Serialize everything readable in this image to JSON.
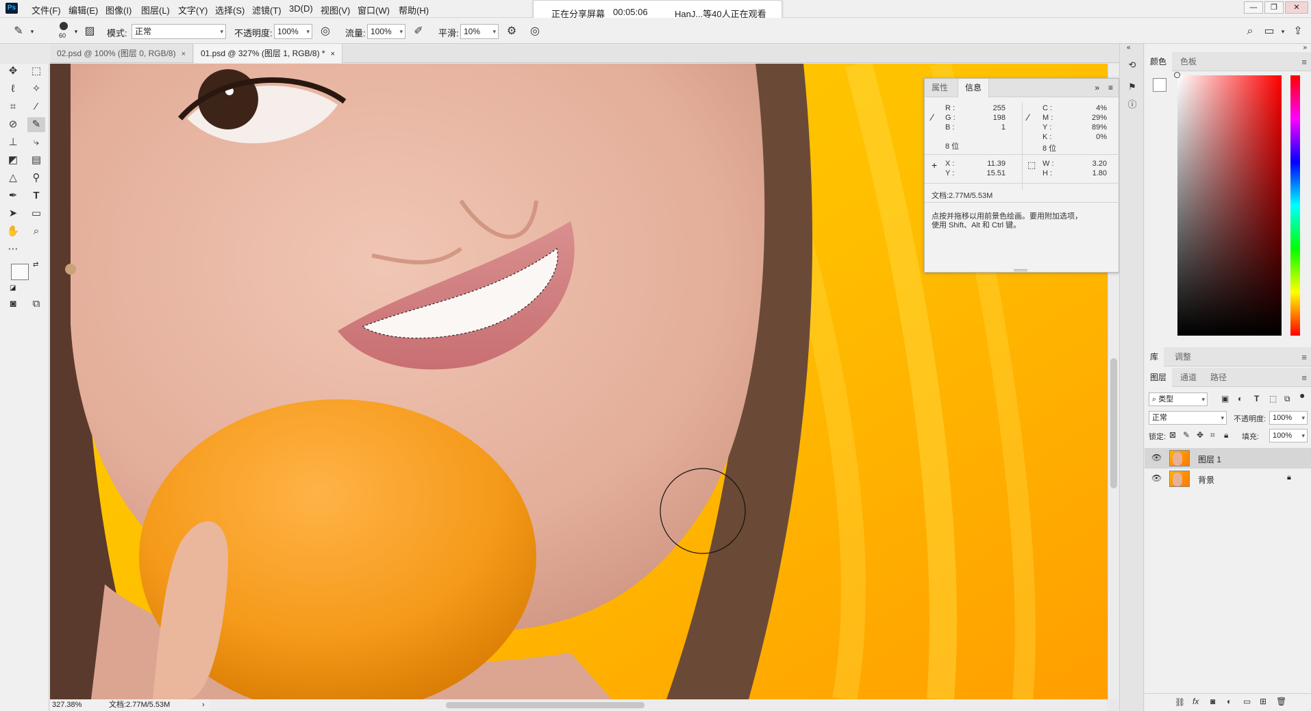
{
  "app": {
    "logo": "Ps"
  },
  "menu": [
    "文件(F)",
    "编辑(E)",
    "图像(I)",
    "图层(L)",
    "文字(Y)",
    "选择(S)",
    "滤镜(T)",
    "3D(D)",
    "视图(V)",
    "窗口(W)",
    "帮助(H)"
  ],
  "share": {
    "status": "正在分享屏幕",
    "time": "00:05:06",
    "viewers": "HanJ...等40人正在观看"
  },
  "options": {
    "brush_size": "60",
    "mode_label": "模式:",
    "mode_value": "正常",
    "opacity_label": "不透明度:",
    "opacity_value": "100%",
    "flow_label": "流量:",
    "flow_value": "100%",
    "smooth_label": "平滑:",
    "smooth_value": "10%"
  },
  "tabs": [
    {
      "label": "02.psd @ 100% (图层 0, RGB/8)",
      "close": "×"
    },
    {
      "label": "01.psd @ 327% (图层 1, RGB/8) *",
      "close": "×"
    }
  ],
  "status": {
    "zoom": "327.38%",
    "doc": "文档:2.77M/5.53M",
    "arrow": "›"
  },
  "info_panel": {
    "tabs": [
      "属性",
      "信息"
    ],
    "rgb": {
      "R": "255",
      "G": "198",
      "B": "1"
    },
    "cmyk": {
      "C": "4%",
      "M": "29%",
      "Y": "89%",
      "K": "0%"
    },
    "bits_left": "8 位",
    "bits_right": "8 位",
    "pos": {
      "X": "11.39",
      "Y": "15.51"
    },
    "size": {
      "W": "3.20",
      "H": "1.80"
    },
    "doc": "文档:2.77M/5.53M",
    "hint_line1": "点按并拖移以用前景色绘画。要用附加选项，",
    "hint_line2": "使用 Shift、Alt 和 Ctrl 键。"
  },
  "color_panel": {
    "tabs": [
      "颜色",
      "色板"
    ]
  },
  "lib_panel": {
    "tabs": [
      "库",
      "调整"
    ]
  },
  "layers_panel": {
    "tabs": [
      "图层",
      "通道",
      "路径"
    ],
    "filter": "类型",
    "blend": "正常",
    "opacity_label": "不透明度:",
    "opacity_value": "100%",
    "lock_label": "锁定:",
    "fill_label": "填充:",
    "fill_value": "100%",
    "layers": [
      {
        "name": "图层 1",
        "selected": true
      },
      {
        "name": "背景",
        "locked": true
      }
    ]
  },
  "colors": {
    "background": "#ffb100",
    "menubar": "#f0f0f0",
    "panel": "#f0f0f0"
  }
}
